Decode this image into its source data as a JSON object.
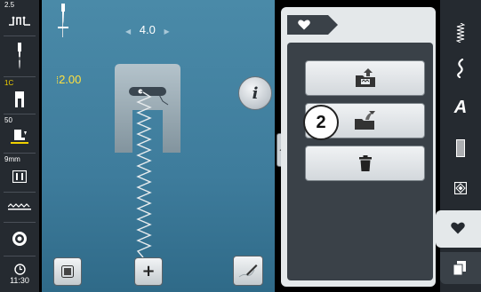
{
  "left_sidebar": {
    "top_value": "2.5",
    "presser_foot_number": "1C",
    "presser_pressure": "50",
    "stitch_length_label": "9mm",
    "clock_time": "11:30"
  },
  "stitch": {
    "width": "4.0",
    "length": "2.00"
  },
  "main": {
    "info_glyph": "i"
  },
  "panel": {
    "tab_icon": "heart-icon",
    "callout_number": "2",
    "actions": [
      {
        "name": "save-to-folder",
        "icon": "folder-upload-icon"
      },
      {
        "name": "overwrite",
        "icon": "folder-overwrite-icon"
      },
      {
        "name": "delete",
        "icon": "trash-icon"
      }
    ]
  },
  "right_tabs": [
    {
      "name": "tab-practical-stitches",
      "icon": "zigzag-stitch-icon"
    },
    {
      "name": "tab-decorative-stitches",
      "icon": "decorative-stitch-icon"
    },
    {
      "name": "tab-alphabets",
      "icon": "letter-a-icon",
      "label": "A"
    },
    {
      "name": "tab-buttonholes",
      "icon": "buttonhole-icon"
    },
    {
      "name": "tab-quilt-stitches",
      "icon": "quilt-icon"
    },
    {
      "name": "tab-personal-program",
      "icon": "heart-icon"
    },
    {
      "name": "tab-memory",
      "icon": "memory-icon"
    }
  ],
  "colors": {
    "main_bg": "#4a8aa8",
    "panel_bg": "#3a4148",
    "accent_yellow": "#ffe040"
  }
}
